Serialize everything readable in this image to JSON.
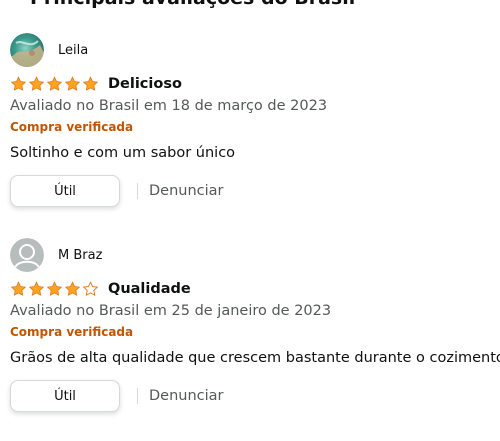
{
  "section_heading": "Principais avaliações do Brasil",
  "colors": {
    "star": "#ffa41c",
    "star_outline": "#de7921",
    "verified": "#c45500",
    "muted_text": "#565959"
  },
  "reviews": [
    {
      "reviewer": "Leila",
      "avatar_icon": "profile-photo",
      "rating": 5,
      "rating_max": 5,
      "title": "Delicioso",
      "date": "Avaliado no Brasil em 18 de março de 2023",
      "verified": "Compra verificada",
      "body": "Soltinho e com um sabor único",
      "helpful_label": "Útil",
      "report_label": "Denunciar"
    },
    {
      "reviewer": "M Braz",
      "avatar_icon": "default-user-icon",
      "rating": 4,
      "rating_max": 5,
      "title": "Qualidade",
      "date": "Avaliado no Brasil em 25 de janeiro de 2023",
      "verified": "Compra verificada",
      "body": "Grãos de alta qualidade que crescem bastante durante o cozimento.",
      "helpful_label": "Útil",
      "report_label": "Denunciar"
    }
  ]
}
